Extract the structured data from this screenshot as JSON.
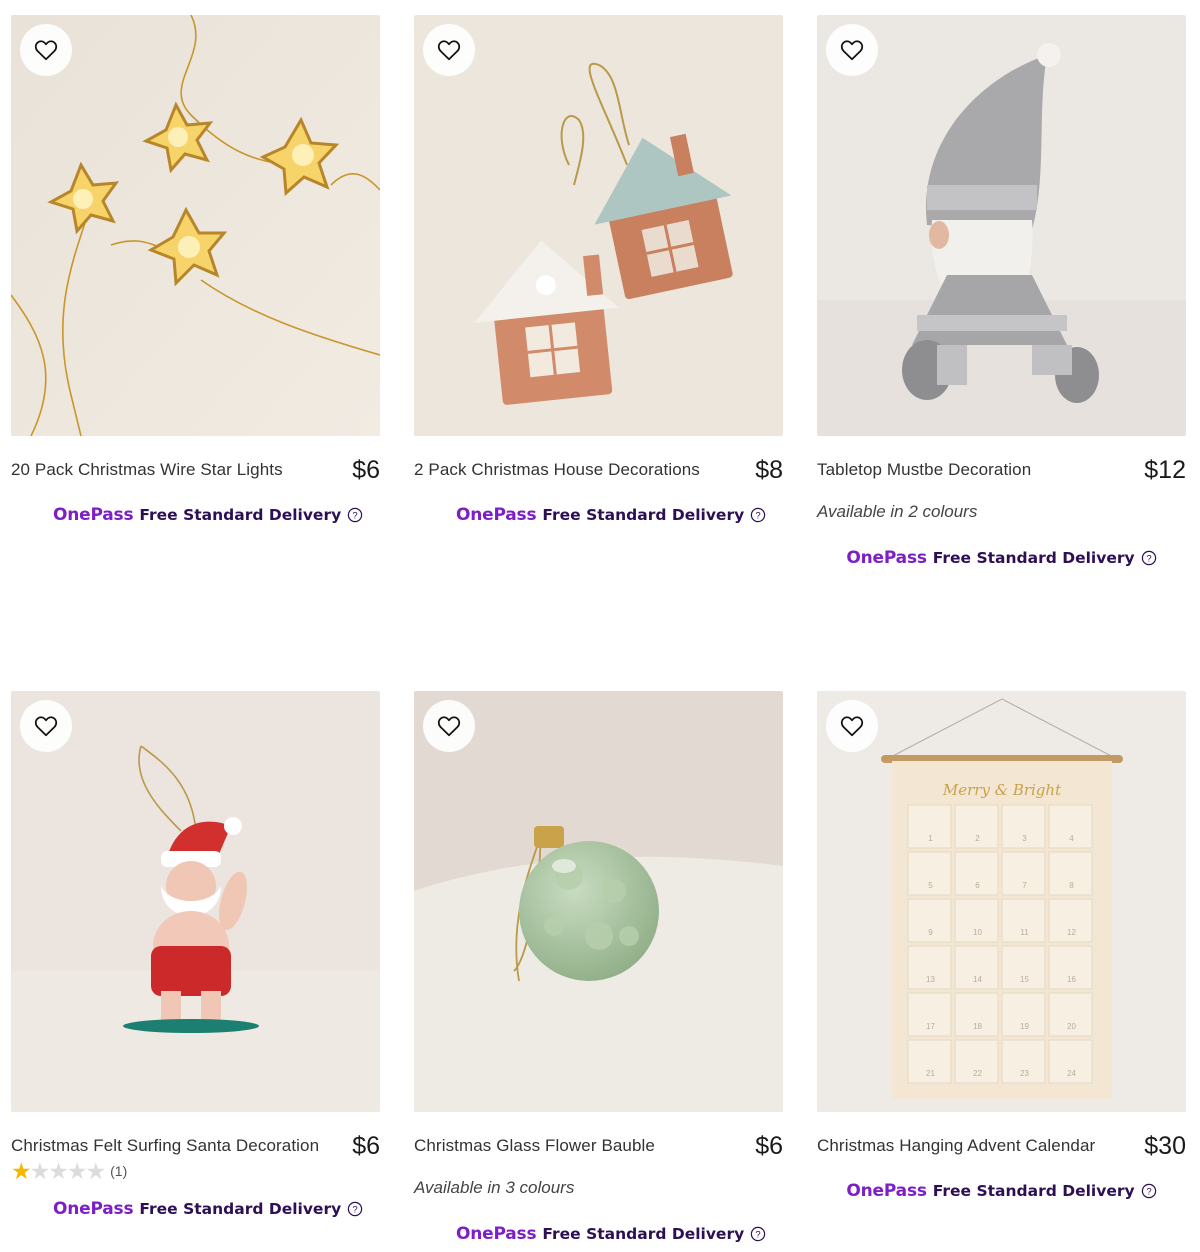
{
  "products": [
    {
      "title": "20 Pack Christmas Wire Star Lights",
      "price": "$6",
      "colours": null,
      "rating": null,
      "delivery": {
        "brand": "OnePass",
        "text": "Free Standard Delivery"
      },
      "image": "gold-wire-star-fairy-lights",
      "wishlist_icon": "heart-outline-icon"
    },
    {
      "title": "2 Pack Christmas House Decorations",
      "price": "$8",
      "colours": null,
      "rating": null,
      "delivery": {
        "brand": "OnePass",
        "text": "Free Standard Delivery"
      },
      "image": "gingerbread-house-ornaments",
      "wishlist_icon": "heart-outline-icon"
    },
    {
      "title": "Tabletop Mustbe Decoration",
      "price": "$12",
      "colours": "Available in 2 colours",
      "rating": null,
      "delivery": {
        "brand": "OnePass",
        "text": "Free Standard Delivery"
      },
      "image": "grey-knitted-gnome",
      "wishlist_icon": "heart-outline-icon"
    },
    {
      "title": "Christmas Felt Surfing Santa Decoration",
      "price": "$6",
      "colours": null,
      "rating": {
        "stars": 1,
        "max": 5,
        "count": "(1)"
      },
      "delivery": {
        "brand": "OnePass",
        "text": "Free Standard Delivery"
      },
      "image": "felt-surfing-santa",
      "wishlist_icon": "heart-outline-icon"
    },
    {
      "title": "Christmas Glass Flower Bauble",
      "price": "$6",
      "colours": "Available in 3 colours",
      "rating": null,
      "delivery": {
        "brand": "OnePass",
        "text": "Free Standard Delivery"
      },
      "image": "green-glass-flower-bauble",
      "wishlist_icon": "heart-outline-icon"
    },
    {
      "title": "Christmas Hanging Advent Calendar",
      "price": "$30",
      "colours": null,
      "rating": null,
      "delivery": {
        "brand": "OnePass",
        "text": "Free Standard Delivery"
      },
      "image": "hanging-advent-calendar",
      "image_text": "Merry & Bright",
      "calendar_numbers": [
        "1",
        "2",
        "3",
        "4",
        "5",
        "6",
        "7",
        "8",
        "9",
        "10",
        "11",
        "12",
        "13",
        "14",
        "15",
        "16",
        "17",
        "18",
        "19",
        "20",
        "21",
        "22",
        "23",
        "24"
      ],
      "wishlist_icon": "heart-outline-icon"
    }
  ],
  "colors": {
    "onepass_brand": "#7d1fc7",
    "delivery_text": "#2d0f54",
    "star_filled": "#f5b800",
    "star_empty": "#dcdcdc"
  }
}
